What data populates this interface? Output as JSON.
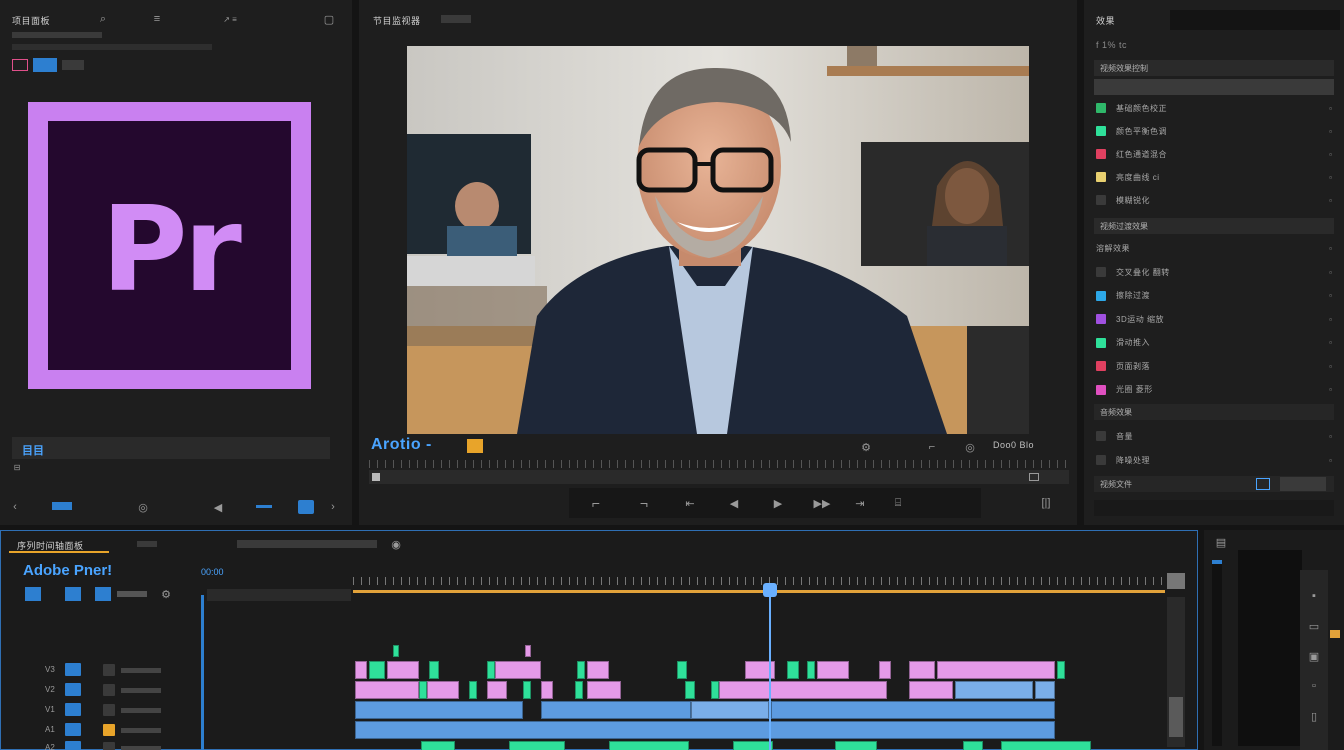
{
  "project_panel": {
    "title": "项目面板",
    "logo_text": "Pr",
    "search_label": "目目"
  },
  "program_monitor": {
    "title": "节目监视器",
    "timecode": "Arotio -",
    "right_controls": "Doo0 Blo"
  },
  "effects_panel": {
    "title": "效果",
    "subtitle": "f 1% tc",
    "group1_label": "视频效果控制",
    "items_a": [
      {
        "label": "基础颜色校正",
        "color": "#2fb86a"
      },
      {
        "label": "颜色平衡色调",
        "color": "#2fe09a"
      },
      {
        "label": "红色通道混合",
        "color": "#e04060"
      },
      {
        "label": "亮度曲线 ci",
        "color": "#e8d070"
      },
      {
        "label": "模糊锐化",
        "color": "#3a3a3a"
      }
    ],
    "group2_label": "视频过渡效果",
    "group2_first": "溶解效果",
    "items_b": [
      {
        "label": "交叉叠化 翻转",
        "color": "#3a3a3a"
      },
      {
        "label": "擦除过渡",
        "color": "#2da8e8"
      },
      {
        "label": "3D运动 缩放",
        "color": "#a050e0"
      },
      {
        "label": "滑动推入",
        "color": "#2fe09a"
      },
      {
        "label": "页面剥落",
        "color": "#e04060"
      },
      {
        "label": "光圈 菱形",
        "color": "#e050c0"
      }
    ],
    "group3_label": "音频效果",
    "items_c": [
      {
        "label": "音量",
        "color": "#3a3a3a"
      },
      {
        "label": "降噪处理",
        "color": "#3a3a3a"
      }
    ],
    "group4_label": "视频文件"
  },
  "timeline": {
    "tab_label": "序列时间轴面板",
    "sequence_name": "Adobe Pner!",
    "timecode": "00:00",
    "tracks": [
      "V3",
      "V2",
      "V1",
      "A1",
      "A2"
    ]
  },
  "colors": {
    "accent_blue": "#2d7fd0",
    "clip_pink": "#e59ae8",
    "clip_green": "#2fe09a",
    "clip_blue": "#5d9be0",
    "playhead": "#6ab0ff",
    "workarea": "#e2a23a"
  }
}
